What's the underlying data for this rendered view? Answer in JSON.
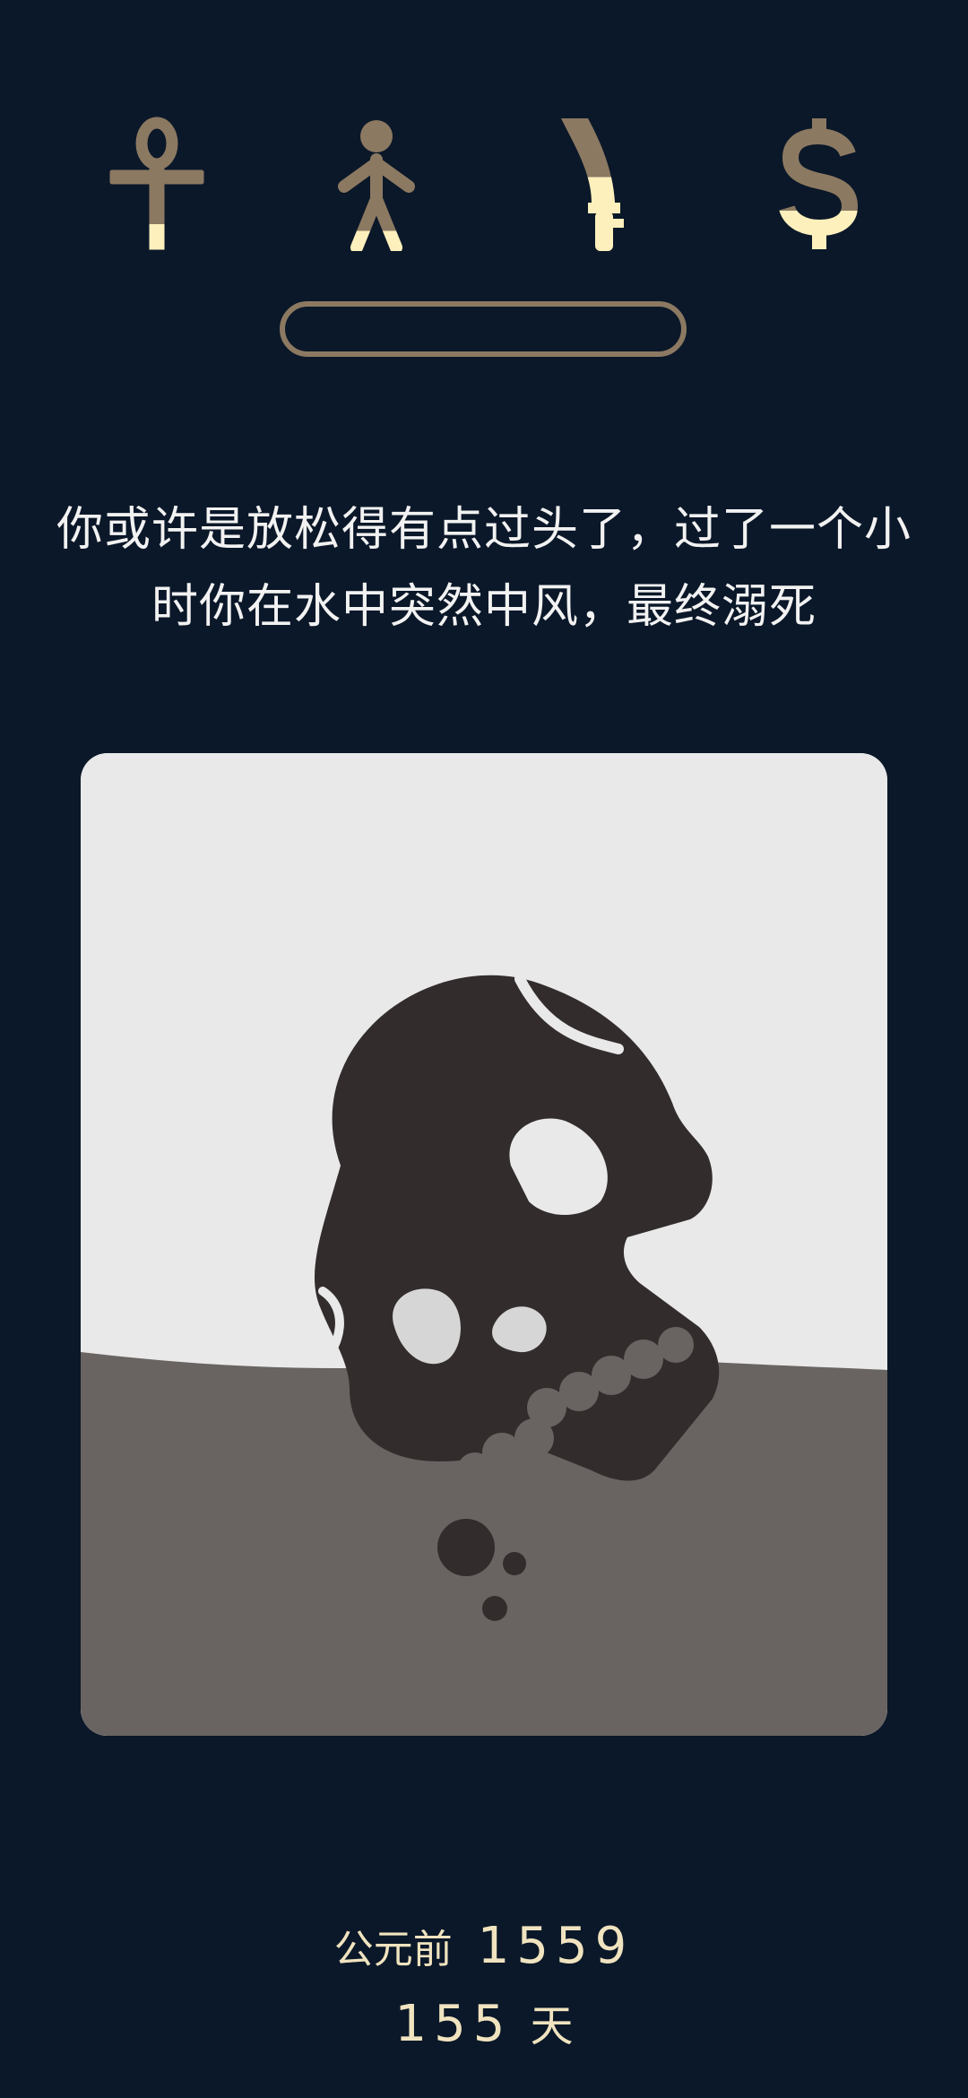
{
  "stats": [
    {
      "icon": "ankh-icon",
      "name": "health",
      "level": 0.2
    },
    {
      "icon": "person-icon",
      "name": "social",
      "level": 0.15
    },
    {
      "icon": "sword-icon",
      "name": "power",
      "level": 0.55
    },
    {
      "icon": "dollar-icon",
      "name": "money",
      "level": 0.3
    }
  ],
  "progress": {
    "value": 0
  },
  "message": "你或许是放松得有点过头了，过了一个小时你在水中突然中风，最终溺死",
  "card": {
    "image": "drowning-skull-illustration"
  },
  "era": {
    "label": "公元前",
    "year": "1559"
  },
  "days": {
    "value": "155",
    "label": "天"
  },
  "colors": {
    "background": "#0b1829",
    "icon_dark": "#8c7962",
    "icon_fill": "#fdf0bd",
    "card_sky": "#e9e9ea",
    "card_water": "#696461",
    "skull": "#332c2c",
    "text": "#f2f2f2",
    "date_text": "#f0e3bf"
  }
}
